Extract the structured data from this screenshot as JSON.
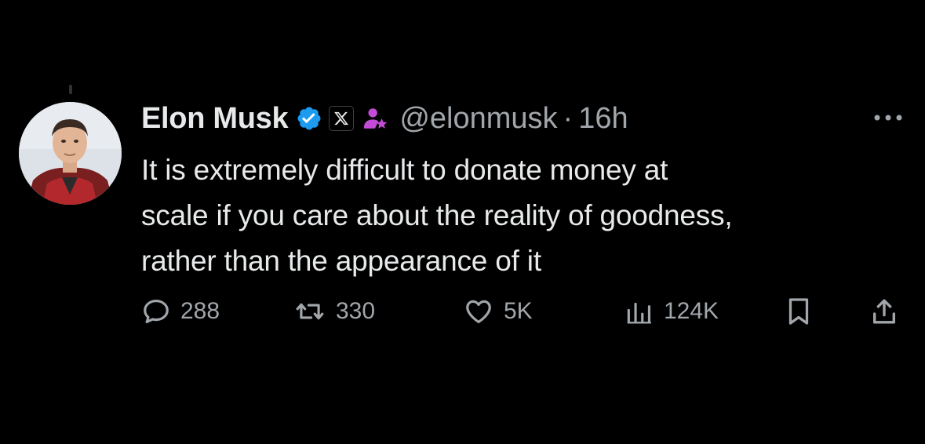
{
  "tweet": {
    "author": {
      "display_name": "Elon Musk",
      "handle": "@elonmusk",
      "avatar": "avatar-photo",
      "badges": [
        "verified-badge-icon",
        "x-affiliate-badge-icon",
        "subscriber-badge-icon"
      ]
    },
    "separator": "·",
    "time": "16h",
    "text": "It is extremely difficult to donate money at\nscale if you care about the reality of goodness,\nrather than the appearance of it",
    "actions": {
      "reply": {
        "icon": "reply-icon",
        "count": "288"
      },
      "repost": {
        "icon": "repost-icon",
        "count": "330"
      },
      "like": {
        "icon": "heart-icon",
        "count": "5K"
      },
      "views": {
        "icon": "views-chart-icon",
        "count": "124K"
      },
      "bookmark": {
        "icon": "bookmark-icon"
      },
      "share": {
        "icon": "share-icon"
      }
    },
    "more_icon": "more-dots-icon"
  },
  "colors": {
    "background": "#000000",
    "primary_text": "#e7e9ea",
    "secondary_text": "#a1a6ab",
    "verified_blue": "#1d9bf0",
    "subscriber_purple": "#c44bd8"
  }
}
